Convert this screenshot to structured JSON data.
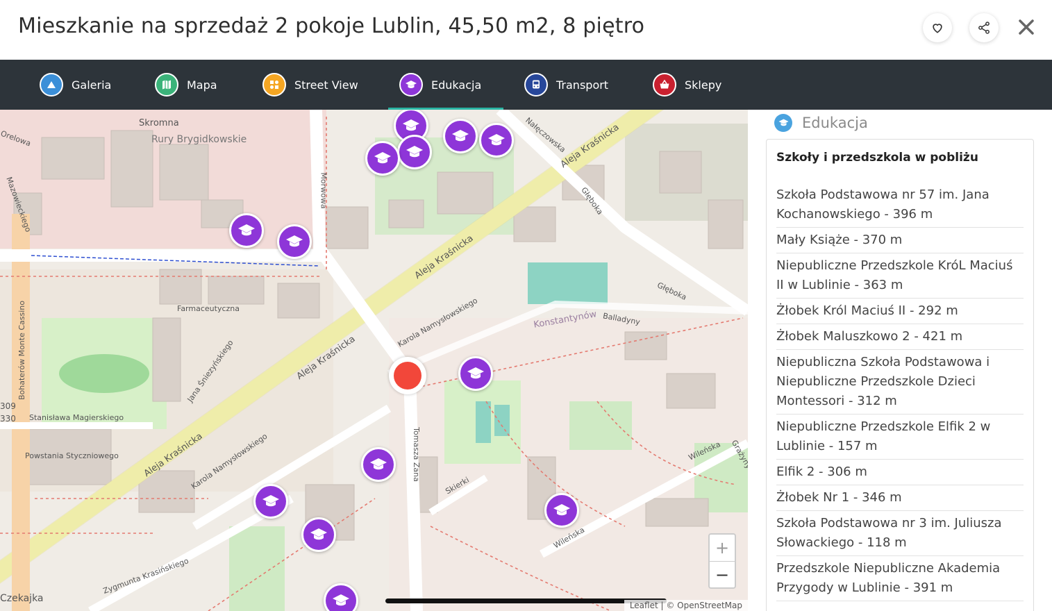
{
  "header": {
    "title": "Mieszkanie na sprzedaż 2 pokoje Lublin, 45,50 m2, 8 piętro",
    "favorite_icon": "heart-icon",
    "share_icon": "share-icon",
    "close_icon": "close-icon"
  },
  "tabs": [
    {
      "label": "Galeria",
      "icon": "gallery-icon",
      "color": "#3b8fd8",
      "active": false
    },
    {
      "label": "Mapa",
      "icon": "map-icon",
      "color": "#3bb37a",
      "active": false
    },
    {
      "label": "Street View",
      "icon": "street-view-icon",
      "color": "#f5a623",
      "active": false
    },
    {
      "label": "Edukacja",
      "icon": "education-icon",
      "color": "#8e36d8",
      "active": true
    },
    {
      "label": "Transport",
      "icon": "bus-icon",
      "color": "#27479a",
      "active": false
    },
    {
      "label": "Sklepy",
      "icon": "shop-basket-icon",
      "color": "#c9202f",
      "active": false
    }
  ],
  "map": {
    "street_labels": [
      "Skromna",
      "Rury Brygidkowskie",
      "Morwowa",
      "Nałęczowska",
      "Aleja Kraśnicka",
      "Głęboka",
      "Farmaceutyczna",
      "Karola Namysłowskiego",
      "Konstantynów",
      "Balladyny",
      "Jana Śniezyńskiego",
      "Stanisława Magierskiego",
      "Powstania Styczniowego",
      "Bohaterów Monte Cassino",
      "Tomasza Zana",
      "Skierki",
      "Wileńska",
      "Zygmunta Krasińskiego",
      "Mazowieckiego",
      "Orelowa",
      "Czekajka",
      "Grażyny",
      "309",
      "330"
    ],
    "zoom_in": "+",
    "zoom_out": "−",
    "attribution": "Leaflet | © OpenStreetMap",
    "marker_color": "#8e36d8",
    "home_marker_color": "#f2473a"
  },
  "panel": {
    "title": "Edukacja",
    "card_title": "Szkoły i przedszkola w pobliżu",
    "items": [
      "Szkoła Podstawowa nr 57 im. Jana Kochanowskiego - 396 m",
      "Mały Książe - 370 m",
      "Niepubliczne Przedszkole KróL Maciuś II w Lublinie - 363 m",
      "Żłobek Król Maciuś II - 292 m",
      "Żłobek Maluszkowo 2 - 421 m",
      "Niepubliczna Szkoła Podstawowa i Niepubliczne Przedszkole Dzieci Montessori - 312 m",
      "Niepubliczne Przedszkole Elfik 2 w Lublinie - 157 m",
      "Elfik 2 - 306 m",
      "Żłobek Nr 1 - 346 m",
      "Szkoła Podstawowa nr 3 im. Juliusza Słowackiego - 118 m",
      "Przedszkole Niepubliczne Akademia Przygody w Lublinie - 391 m"
    ]
  }
}
